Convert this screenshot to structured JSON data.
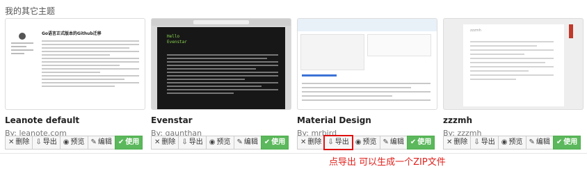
{
  "section_title": "我的其它主题",
  "buttons": {
    "delete": "删除",
    "export": "导出",
    "preview": "预览",
    "edit": "编辑",
    "use": "使用"
  },
  "themes": [
    {
      "name": "Leanote default",
      "by": "By: leanote.com",
      "thumb_title": "Go语言正式版本的Github迁移"
    },
    {
      "name": "Evenstar",
      "by": "By: gaunthan",
      "thumb_title": "Hello",
      "thumb_subtitle": "Evenstar"
    },
    {
      "name": "Material Design",
      "by": "By: mrbird"
    },
    {
      "name": "zzzmh",
      "by": "By: zzzmh",
      "thumb_title": "zzzmh"
    }
  ],
  "annotation": "点导出 可以生成一个ZIP文件",
  "colors": {
    "use_button": "#5cb85c",
    "highlight": "#e01010",
    "annotation": "#e0201b"
  }
}
